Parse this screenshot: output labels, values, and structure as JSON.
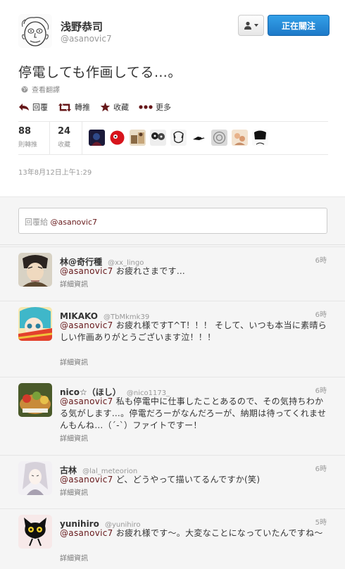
{
  "author": {
    "name": "浅野恭司",
    "handle": "@asanovic7"
  },
  "follow_button": {
    "label": "正在關注"
  },
  "tweet": {
    "text": "停電しても作画してる…。",
    "translate_label": "查看翻譯",
    "timestamp": "13年8月12日上午1:29"
  },
  "actions": [
    {
      "label": "回覆",
      "icon": "reply-arrow-icon"
    },
    {
      "label": "轉推",
      "icon": "retweet-icon"
    },
    {
      "label": "收藏",
      "icon": "star-icon"
    },
    {
      "label": "更多",
      "icon": "more-dots-icon"
    }
  ],
  "stats": {
    "retweets": {
      "count": "88",
      "label": "則轉推"
    },
    "favorites": {
      "count": "24",
      "label": "收藏"
    },
    "favoriters_shown": 9
  },
  "reply_box": {
    "prefix": "回覆給",
    "mention": "@asanovic7"
  },
  "replies": [
    {
      "name": "林@奇行種",
      "handle": "@xx_lingo",
      "time": "6時",
      "mention": "@asanovic7",
      "text": "お疲れさまです…",
      "details": "詳細資訊"
    },
    {
      "name": "MIKAKO",
      "handle": "@TbMkmk39",
      "time": "6時",
      "mention": "@asanovic7",
      "text": "お疲れ様ですT^T！！！ そして、いつも本当に素晴らしい作画ありがとうございます泣！！！",
      "details": "詳細資訊"
    },
    {
      "name": "nico☆（ほし）",
      "handle": "@nico1173_",
      "time": "6時",
      "mention": "@asanovic7",
      "text": "私も停電中に仕事したことあるので、その気持ちわかる気がします…。停電だろーがなんだろーが、納期は待ってくれませんもんね…（´-`）ファイトですー！",
      "details": "詳細資訊"
    },
    {
      "name": "古林",
      "handle": "@lal_meteorion",
      "time": "6時",
      "mention": "@asanovic7",
      "text": "ど、どうやって描いてるんですか(笑)",
      "details": "詳細資訊"
    },
    {
      "name": "yunihiro",
      "handle": "@yunihiro",
      "time": "5時",
      "mention": "@asanovic7",
      "text": "お疲れ様です〜。大変なことになっていたんですね〜",
      "details": "詳細資訊"
    }
  ],
  "colors": {
    "accent": "#66181a",
    "follow_blue": "#2b8ed9",
    "band_bg": "#f5f5f5"
  }
}
